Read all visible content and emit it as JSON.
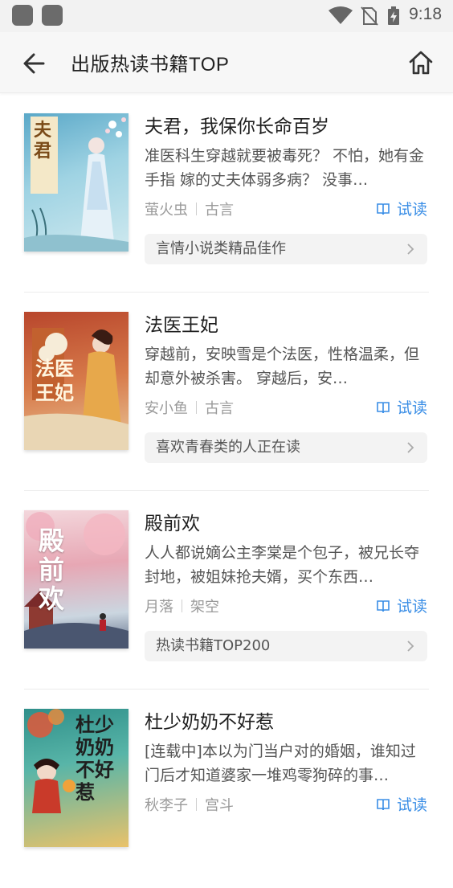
{
  "status_bar": {
    "time": "9:18"
  },
  "header": {
    "title": "出版热读书籍TOP"
  },
  "try_read_label": "试读",
  "books": [
    {
      "title": "夫君，我保你长命百岁",
      "desc": "准医科生穿越就要被毒死？ 不怕，她有金手指 嫁的丈夫体弱多病？ 没事…",
      "author": "萤火虫",
      "genre": "古言",
      "tag": "言情小说类精品佳作",
      "cover_text": "夫君"
    },
    {
      "title": "法医王妃",
      "desc": "穿越前，安映雪是个法医，性格温柔，但却意外被杀害。 穿越后，安…",
      "author": "安小鱼",
      "genre": "古言",
      "tag": "喜欢青春类的人正在读",
      "cover_text": "法医王妃"
    },
    {
      "title": "殿前欢",
      "desc": "人人都说嫡公主李棠是个包子，被兄长夺封地，被姐妹抢夫婿，买个东西…",
      "author": "月落",
      "genre": "架空",
      "tag": "热读书籍TOP200",
      "cover_text": "殿前欢"
    },
    {
      "title": "杜少奶奶不好惹",
      "desc": "[连载中]本以为门当户对的婚姻，谁知过门后才知道婆家一堆鸡零狗碎的事…",
      "author": "秋李子",
      "genre": "宫斗",
      "tag": "",
      "cover_text": "杜少奶奶不好惹"
    }
  ]
}
